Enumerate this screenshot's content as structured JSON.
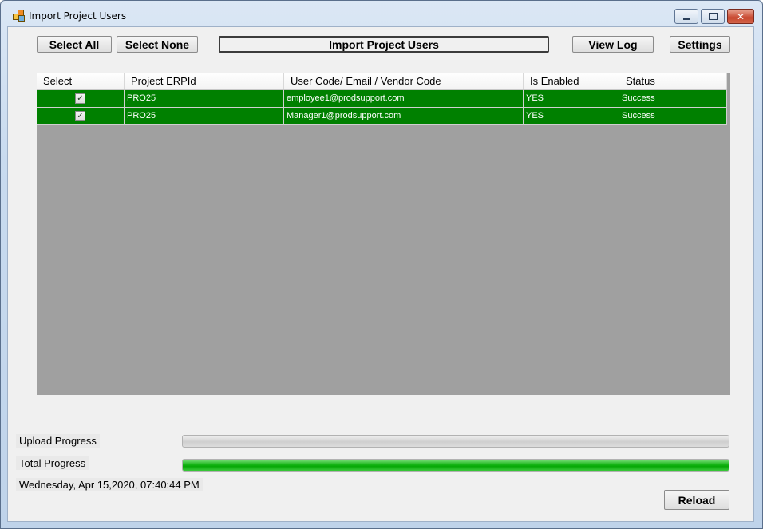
{
  "window": {
    "title": "Import Project Users",
    "minimize_glyph": "",
    "close_glyph": "✕"
  },
  "toolbar": {
    "select_all": "Select All",
    "select_none": "Select None",
    "import": "Import Project Users",
    "view_log": "View Log",
    "settings": "Settings"
  },
  "grid": {
    "columns": [
      "Select",
      "Project ERPId",
      "User Code/ Email / Vendor Code",
      "Is Enabled",
      "Status"
    ],
    "rows": [
      {
        "checked": true,
        "project": "PRO25",
        "user": "employee1@prodsupport.com",
        "enabled": "YES",
        "status": "Success"
      },
      {
        "checked": true,
        "project": "PRO25",
        "user": "Manager1@prodsupport.com",
        "enabled": "YES",
        "status": "Success"
      }
    ],
    "row_color": "#008000",
    "check_glyph": "✓"
  },
  "progress": {
    "upload_label": "Upload Progress",
    "upload_value": 0,
    "total_label": "Total Progress",
    "total_value": 100
  },
  "status": {
    "timestamp": "Wednesday, Apr 15,2020, 07:40:44 PM"
  },
  "footer": {
    "reload": "Reload"
  }
}
